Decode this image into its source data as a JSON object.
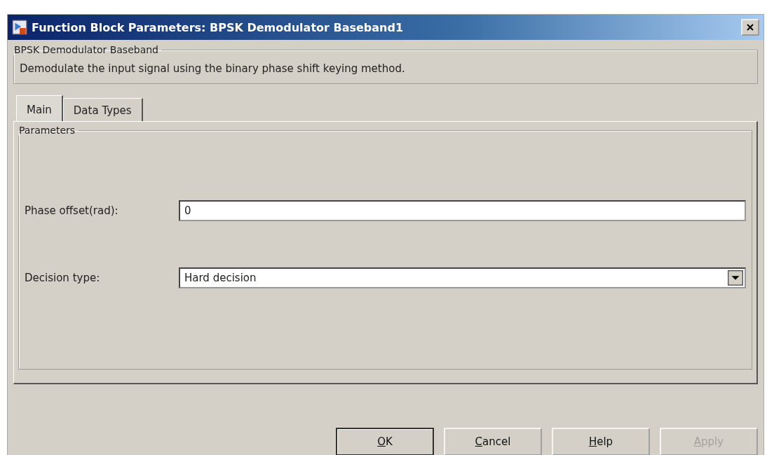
{
  "window": {
    "title": "Function Block Parameters: BPSK Demodulator Baseband1"
  },
  "description": {
    "heading": "BPSK Demodulator Baseband",
    "text": "Demodulate the input signal using the binary phase shift keying method."
  },
  "tabs": [
    {
      "label": "Main",
      "selected": true
    },
    {
      "label": "Data Types",
      "selected": false
    }
  ],
  "parameters": {
    "heading": "Parameters",
    "fields": [
      {
        "kind": "text",
        "label": "Phase offset(rad):",
        "value": "0"
      },
      {
        "kind": "dropdown",
        "label": "Decision type:",
        "value": "Hard decision"
      }
    ]
  },
  "buttons": [
    {
      "label": "OK",
      "disabled": false,
      "default": true
    },
    {
      "label": "Cancel",
      "disabled": false,
      "default": false
    },
    {
      "label": "Help",
      "disabled": false,
      "default": false
    },
    {
      "label": "Apply",
      "disabled": true,
      "default": false
    }
  ]
}
